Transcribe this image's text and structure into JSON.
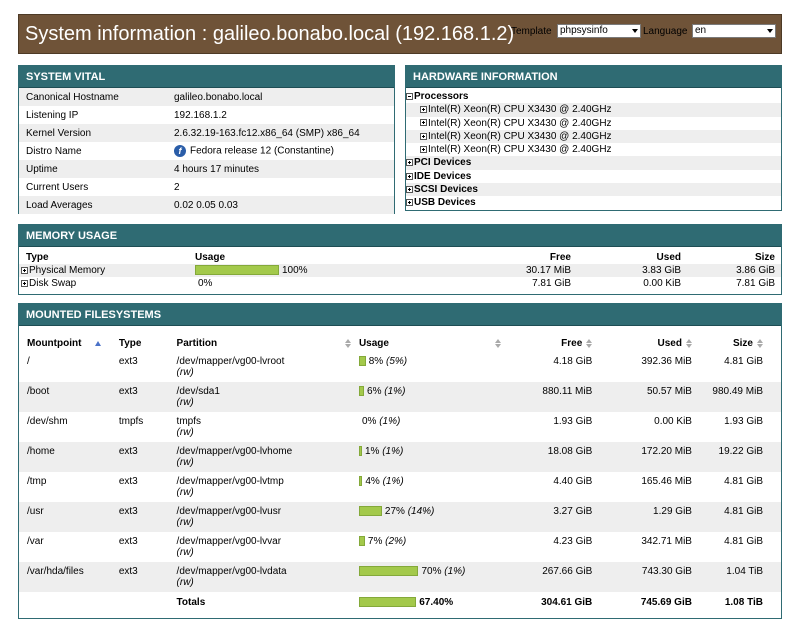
{
  "header": {
    "title": "System information : galileo.bonabo.local (192.168.1.2)",
    "template_label": "Template",
    "template_value": "phpsysinfo",
    "language_label": "Language",
    "language_value": "en"
  },
  "vital": {
    "title": "SYSTEM VITAL",
    "rows": [
      {
        "key": "Canonical Hostname",
        "value": "galileo.bonabo.local"
      },
      {
        "key": "Listening IP",
        "value": "192.168.1.2"
      },
      {
        "key": "Kernel Version",
        "value": "2.6.32.19-163.fc12.x86_64 (SMP) x86_64"
      },
      {
        "key": "Distro Name",
        "value": "Fedora release 12 (Constantine)",
        "icon": "fedora-logo-icon"
      },
      {
        "key": "Uptime",
        "value": "4 hours 17 minutes"
      },
      {
        "key": "Current Users",
        "value": "2"
      },
      {
        "key": "Load Averages",
        "value": "0.02 0.05 0.03"
      }
    ]
  },
  "hardware": {
    "title": "HARDWARE INFORMATION",
    "processors_label": "Processors",
    "cpus": [
      "Intel(R) Xeon(R) CPU X3430 @ 2.40GHz",
      "Intel(R) Xeon(R) CPU X3430 @ 2.40GHz",
      "Intel(R) Xeon(R) CPU X3430 @ 2.40GHz",
      "Intel(R) Xeon(R) CPU X3430 @ 2.40GHz"
    ],
    "groups": [
      "PCI Devices",
      "IDE Devices",
      "SCSI Devices",
      "USB Devices"
    ]
  },
  "memory": {
    "title": "MEMORY USAGE",
    "headers": {
      "type": "Type",
      "usage": "Usage",
      "free": "Free",
      "used": "Used",
      "size": "Size"
    },
    "rows": [
      {
        "type": "Physical Memory",
        "usage_pct": 100,
        "usage_text": "100%",
        "free": "30.17 MiB",
        "used": "3.83 GiB",
        "size": "3.86 GiB"
      },
      {
        "type": "Disk Swap",
        "usage_pct": 0,
        "usage_text": "0%",
        "free": "7.81 GiB",
        "used": "0.00 KiB",
        "size": "7.81 GiB"
      }
    ]
  },
  "filesystems": {
    "title": "MOUNTED FILESYSTEMS",
    "headers": {
      "mount": "Mountpoint",
      "type": "Type",
      "partition": "Partition",
      "usage": "Usage",
      "free": "Free",
      "used": "Used",
      "size": "Size"
    },
    "rows": [
      {
        "mount": "/",
        "type": "ext3",
        "partition": "/dev/mapper/vg00-lvroot",
        "opts": "(rw)",
        "usage_pct": 8,
        "pct": "8%",
        "inode": "(5%)",
        "free": "4.18 GiB",
        "used": "392.36 MiB",
        "size": "4.81 GiB"
      },
      {
        "mount": "/boot",
        "type": "ext3",
        "partition": "/dev/sda1",
        "opts": "(rw)",
        "usage_pct": 6,
        "pct": "6%",
        "inode": "(1%)",
        "free": "880.11 MiB",
        "used": "50.57 MiB",
        "size": "980.49 MiB"
      },
      {
        "mount": "/dev/shm",
        "type": "tmpfs",
        "partition": "tmpfs",
        "opts": "(rw)",
        "usage_pct": 0,
        "pct": "0%",
        "inode": "(1%)",
        "free": "1.93 GiB",
        "used": "0.00 KiB",
        "size": "1.93 GiB"
      },
      {
        "mount": "/home",
        "type": "ext3",
        "partition": "/dev/mapper/vg00-lvhome",
        "opts": "(rw)",
        "usage_pct": 1,
        "pct": "1%",
        "inode": "(1%)",
        "free": "18.08 GiB",
        "used": "172.20 MiB",
        "size": "19.22 GiB"
      },
      {
        "mount": "/tmp",
        "type": "ext3",
        "partition": "/dev/mapper/vg00-lvtmp",
        "opts": "(rw)",
        "usage_pct": 4,
        "pct": "4%",
        "inode": "(1%)",
        "free": "4.40 GiB",
        "used": "165.46 MiB",
        "size": "4.81 GiB"
      },
      {
        "mount": "/usr",
        "type": "ext3",
        "partition": "/dev/mapper/vg00-lvusr",
        "opts": "(rw)",
        "usage_pct": 27,
        "pct": "27%",
        "inode": "(14%)",
        "free": "3.27 GiB",
        "used": "1.29 GiB",
        "size": "4.81 GiB"
      },
      {
        "mount": "/var",
        "type": "ext3",
        "partition": "/dev/mapper/vg00-lvvar",
        "opts": "(rw)",
        "usage_pct": 7,
        "pct": "7%",
        "inode": "(2%)",
        "free": "4.23 GiB",
        "used": "342.71 MiB",
        "size": "4.81 GiB"
      },
      {
        "mount": "/var/hda/files",
        "type": "ext3",
        "partition": "/dev/mapper/vg00-lvdata",
        "opts": "(rw)",
        "usage_pct": 70,
        "pct": "70%",
        "inode": "(1%)",
        "free": "267.66 GiB",
        "used": "743.30 GiB",
        "size": "1.04 TiB"
      }
    ],
    "totals": {
      "label": "Totals",
      "usage_pct": 67.4,
      "pct": "67.40%",
      "free": "304.61 GiB",
      "used": "745.69 GiB",
      "size": "1.08 TiB"
    }
  }
}
